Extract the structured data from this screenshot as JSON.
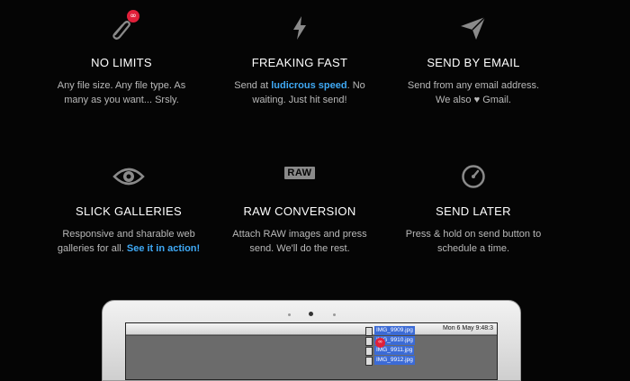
{
  "features": [
    {
      "title": "NO LIMITS",
      "desc_lines": [
        "Any file size. Any file type. As",
        "many as you want... Srsly."
      ],
      "icon": "paperclip-icon",
      "badge": "∞"
    },
    {
      "title": "FREAKING FAST",
      "desc_pre": "Send at ",
      "desc_link": "ludicrous speed",
      "desc_post": ". No",
      "desc_line2": "waiting. Just hit send!",
      "icon": "lightning-icon"
    },
    {
      "title": "SEND BY EMAIL",
      "desc_lines": [
        "Send from any email address.",
        "We also ♥ Gmail."
      ],
      "icon": "paper-plane-icon"
    },
    {
      "title": "SLICK GALLERIES",
      "desc_line1": "Responsive and sharable web",
      "desc_pre": "galleries for all. ",
      "desc_link": "See it in action!",
      "icon": "eye-icon"
    },
    {
      "title": "RAW CONVERSION",
      "desc_lines": [
        "Attach RAW images and press",
        "send. We'll do the rest."
      ],
      "icon": "raw-icon",
      "icon_text": "RAW"
    },
    {
      "title": "SEND LATER",
      "desc_lines": [
        "Press & hold on send button to",
        "schedule a time."
      ],
      "icon": "clock-icon"
    }
  ],
  "laptop": {
    "clock": "Mon 6 May  9:48:3",
    "files": [
      "IMG_9909.jpg",
      "IMG_9910.jpg",
      "IMG_9911.jpg",
      "IMG_9912.jpg"
    ],
    "drag_badge": "∞"
  },
  "colors": {
    "background": "#050505",
    "accent": "#3fa9f5",
    "badge": "#e0203a",
    "icon": "#8a8a8a"
  }
}
